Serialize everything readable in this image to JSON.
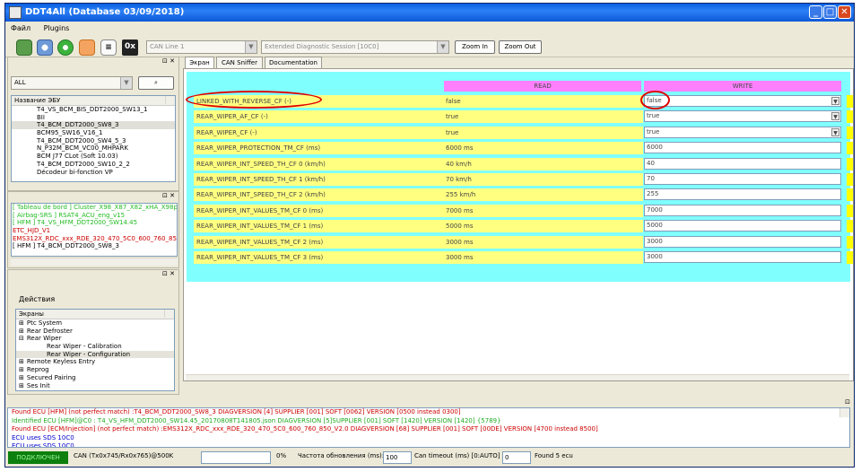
{
  "window": {
    "title": "DDT4All (Database 03/09/2018)"
  },
  "menu": [
    "Файл",
    "Plugins"
  ],
  "toolbar": {
    "can_line": "CAN Line 1",
    "session": "Extended Diagnostic Session [10C0]",
    "zoom_in": "Zoom In",
    "zoom_out": "Zoom Out",
    "hex_label": "0x"
  },
  "left": {
    "panel_ctrl": "⊡ ✕",
    "filter": "ALL",
    "ecu_header": "Название ЭБУ",
    "ecu_list": [
      "T4_VS_BCM_BIS_DDT2000_SW13_1",
      "BII",
      "T4_BCM_DDT2000_SW8_3",
      "BCM95_SW16_V16_1",
      "T4_BCM_DDT2000_SW4_5_3",
      "N_P32M_BCM_VC00_MHPARK",
      "BCM J77 CLot (Soft 10.03)",
      "T4_BCM_DDT2000_SW10_2_2",
      "Décodeur bi-fonction VP"
    ],
    "found_list": [
      {
        "text": "[ Tableau de bord ] Cluster_X98_X87_X82_xHA_X98ph2",
        "color": "#22bb22"
      },
      {
        "text": "[ Airbag-SRS ] RSAT4_ACU_eng_v15",
        "color": "#22bb22"
      },
      {
        "text": "[ HFM ] T4_VS_HFM_DDT2000_SW14.45",
        "color": "#22bb22"
      },
      {
        "text": "ETC_HJD_V1",
        "color": "#cc0000"
      },
      {
        "text": "EMS312X_RDC_xxx_RDE_320_470_5C0_600_760_850",
        "color": "#cc0000"
      },
      {
        "text": "[ HFM ] T4_BCM_DDT2000_SW8_3",
        "color": "#000000"
      }
    ],
    "actions_title": "Действия",
    "screens_header": "Экраны",
    "tree": [
      {
        "text": "Ptc System",
        "sign": "⊞",
        "indent": 0
      },
      {
        "text": "Rear Defroster",
        "sign": "⊞",
        "indent": 0
      },
      {
        "text": "Rear Wiper",
        "sign": "⊟",
        "indent": 0
      },
      {
        "text": "Rear Wiper - Calibration",
        "sign": "",
        "indent": 1
      },
      {
        "text": "Rear Wiper - Configuration",
        "sign": "",
        "indent": 1,
        "selected": true
      },
      {
        "text": "Remote Keyless Entry",
        "sign": "⊞",
        "indent": 0
      },
      {
        "text": "Reprog",
        "sign": "⊞",
        "indent": 0
      },
      {
        "text": "Secured Pairing",
        "sign": "⊞",
        "indent": 0
      },
      {
        "text": "Ses Init",
        "sign": "⊞",
        "indent": 0
      }
    ]
  },
  "tabs": [
    "Экран",
    "CAN Sniffer",
    "Documentation"
  ],
  "screen": {
    "read_header": "READ",
    "write_header": "WRITE",
    "rows": [
      {
        "label": "LINKED_WITH_REVERSE_CF (-)",
        "read": "false",
        "write": "false",
        "dropdown": true
      },
      {
        "label": "REAR_WIPER_AF_CF (-)",
        "read": "true",
        "write": "true",
        "dropdown": true
      },
      {
        "label": "REAR_WIPER_CF (-)",
        "read": "true",
        "write": "true",
        "dropdown": true
      },
      {
        "label": "REAR_WIPER_PROTECTION_TM_CF (ms)",
        "read": "6000 ms",
        "write": "6000",
        "dropdown": false
      },
      {
        "label": "REAR_WIPER_INT_SPEED_TH_CF 0 (km/h)",
        "read": "40 km/h",
        "write": "40",
        "dropdown": false
      },
      {
        "label": "REAR_WIPER_INT_SPEED_TH_CF 1 (km/h)",
        "read": "70 km/h",
        "write": "70",
        "dropdown": false
      },
      {
        "label": "REAR_WIPER_INT_SPEED_TH_CF 2 (km/h)",
        "read": "255 km/h",
        "write": "255",
        "dropdown": false
      },
      {
        "label": "REAR_WIPER_INT_VALUES_TM_CF 0 (ms)",
        "read": "7000 ms",
        "write": "7000",
        "dropdown": false
      },
      {
        "label": "REAR_WIPER_INT_VALUES_TM_CF 1 (ms)",
        "read": "5000 ms",
        "write": "5000",
        "dropdown": false
      },
      {
        "label": "REAR_WIPER_INT_VALUES_TM_CF 2 (ms)",
        "read": "3000 ms",
        "write": "3000",
        "dropdown": false
      },
      {
        "label": "REAR_WIPER_INT_VALUES_TM_CF 3 (ms)",
        "read": "3000 ms",
        "write": "3000",
        "dropdown": false
      }
    ]
  },
  "log": {
    "lines": [
      {
        "text": "Found ECU [HFM] (not perfect match) :T4_BCM_DDT2000_SW8_3 DIAGVERSION [4] SUPPLIER [001] SOFT [0062] VERSION [0500 instead 0300]",
        "color": "#cc0000"
      },
      {
        "text": "Identified ECU [HFM]@C0 : T4_VS_HFM_DDT2000_SW14.45_20170808T141805.json DIAGVERSION [5]SUPPLIER [001] SOFT [1420] VERSION [1420] {5789}",
        "color": "#22aa22"
      },
      {
        "text": "Found ECU [ECM/Injection] (not perfect match) :EMS312X_RDC_xxx_RDE_320_470_5C0_600_760_850_V2.0 DIAGVERSION [68] SUPPLIER [001] SOFT [00DE] VERSION [4700 instead 8500]",
        "color": "#cc0000"
      },
      {
        "text": "ECU uses SDS 10C0",
        "color": "#0000cc",
        "suffix_color": "#cc8800"
      },
      {
        "text": "ECU uses SDS 10C0",
        "color": "#0000cc",
        "suffix_color": "#cc8800"
      }
    ]
  },
  "status": {
    "connected": "ПОДКЛЮЧЕН",
    "can_info": "CAN (Tx0x745/Rx0x765)@500K",
    "progress_pct": "0%",
    "refresh_label": "Частота обновления (ms):",
    "refresh_value": "100",
    "timeout_label": "Can timeout (ms) [0:AUTO] :",
    "timeout_value": "0",
    "found": "Found 5 ecu"
  },
  "colors": {
    "cyan": "#80ffff",
    "magenta": "#ff80ff",
    "yellow": "#ffff80",
    "highlight": "#e00000"
  }
}
